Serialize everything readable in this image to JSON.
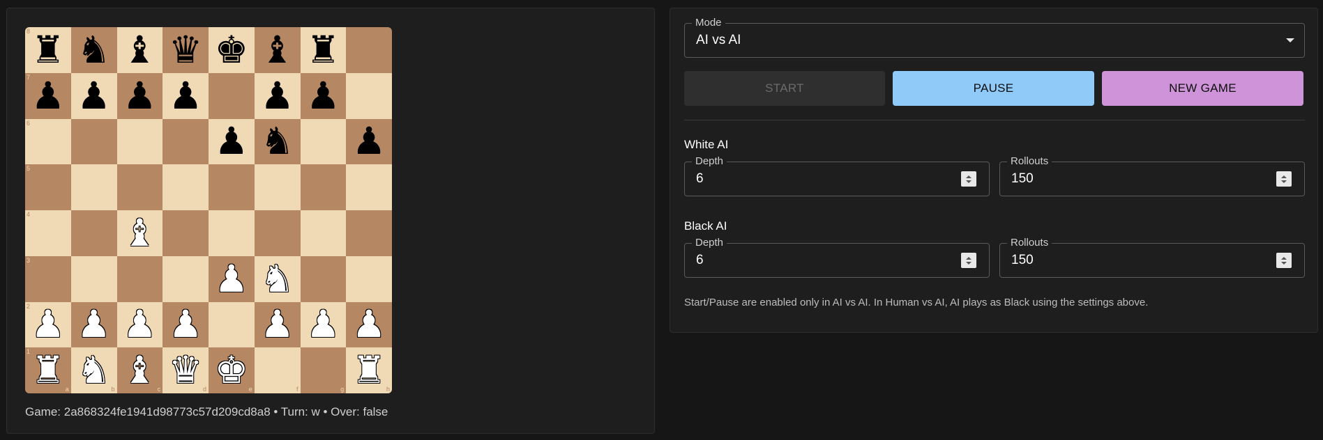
{
  "board": {
    "files": [
      "a",
      "b",
      "c",
      "d",
      "e",
      "f",
      "g",
      "h"
    ],
    "ranks": [
      "8",
      "7",
      "6",
      "5",
      "4",
      "3",
      "2",
      "1"
    ],
    "rows": [
      [
        "bR",
        "bN",
        "bB",
        "bQ",
        "bK",
        "bB",
        "bR",
        ""
      ],
      [
        "bP",
        "bP",
        "bP",
        "bP",
        "",
        "bP",
        "bP",
        ""
      ],
      [
        "",
        "",
        "",
        "",
        "bP",
        "bN",
        "",
        "bP"
      ],
      [
        "",
        "",
        "",
        "",
        "",
        "",
        "",
        ""
      ],
      [
        "",
        "",
        "wB",
        "",
        "",
        "",
        "",
        ""
      ],
      [
        "",
        "",
        "",
        "",
        "wP",
        "wN",
        "",
        ""
      ],
      [
        "wP",
        "wP",
        "wP",
        "wP",
        "",
        "wP",
        "wP",
        "wP"
      ],
      [
        "wR",
        "wN",
        "wB",
        "wQ",
        "wK",
        "",
        "",
        "wR"
      ]
    ],
    "colors": {
      "light": "#f0d9b5",
      "dark": "#b58863"
    }
  },
  "status": {
    "text": "Game: 2a868324fe1941d98773c57d209cd8a8 • Turn: w • Over: false"
  },
  "mode": {
    "label": "Mode",
    "value": "AI vs AI"
  },
  "buttons": {
    "start": "START",
    "pause": "PAUSE",
    "new_game": "NEW GAME"
  },
  "white_ai": {
    "title": "White AI",
    "depth_label": "Depth",
    "depth": "6",
    "rollouts_label": "Rollouts",
    "rollouts": "150"
  },
  "black_ai": {
    "title": "Black AI",
    "depth_label": "Depth",
    "depth": "6",
    "rollouts_label": "Rollouts",
    "rollouts": "150"
  },
  "help": "Start/Pause are enabled only in AI vs AI. In Human vs AI, AI plays as Black using the settings above.",
  "accent": {
    "pause": "#90caf9",
    "new_game": "#ce93d8"
  }
}
